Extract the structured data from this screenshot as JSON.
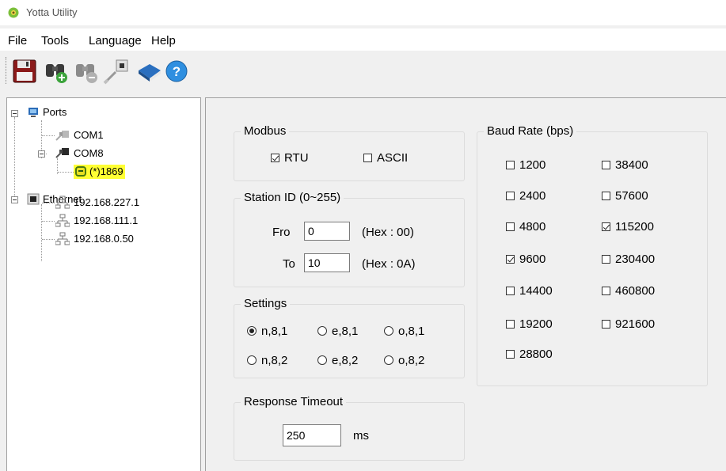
{
  "window": {
    "title": "Yotta Utility"
  },
  "menu": {
    "file": "File",
    "tools": "Tools",
    "language": "Language",
    "help": "Help"
  },
  "toolbar": {
    "buttons": [
      "save-icon",
      "search-add-icon",
      "search-remove-icon",
      "connect-icon",
      "book-icon",
      "help-icon"
    ]
  },
  "tree": {
    "ports_label": "Ports",
    "com1_label": "COM1",
    "com8_label": "COM8",
    "device_label": "(*)1869",
    "ethernet_label": "Ethernet",
    "ip1": "192.168.227.1",
    "ip2": "192.168.111.1",
    "ip3": "192.168.0.50"
  },
  "modbus": {
    "title": "Modbus",
    "rtu_label": "RTU",
    "rtu_checked": true,
    "ascii_label": "ASCII",
    "ascii_checked": false
  },
  "station": {
    "title": "Station ID (0~255)",
    "from_label": "Fro",
    "from_value": "0",
    "from_hex": "(Hex : 00)",
    "to_label": "To",
    "to_value": "10",
    "to_hex": "(Hex : 0A)"
  },
  "settings": {
    "title": "Settings",
    "options": [
      "n,8,1",
      "e,8,1",
      "o,8,1",
      "n,8,2",
      "e,8,2",
      "o,8,2"
    ],
    "selected": "n,8,1"
  },
  "timeout": {
    "title": "Response Timeout",
    "value": "250",
    "unit": "ms"
  },
  "baud": {
    "title": "Baud Rate (bps)",
    "left": [
      {
        "label": "1200",
        "checked": false
      },
      {
        "label": "2400",
        "checked": false
      },
      {
        "label": "4800",
        "checked": false
      },
      {
        "label": "9600",
        "checked": true
      },
      {
        "label": "14400",
        "checked": false
      },
      {
        "label": "19200",
        "checked": false
      },
      {
        "label": "28800",
        "checked": false
      }
    ],
    "right": [
      {
        "label": "38400",
        "checked": false
      },
      {
        "label": "57600",
        "checked": false
      },
      {
        "label": "115200",
        "checked": true
      },
      {
        "label": "230400",
        "checked": false
      },
      {
        "label": "460800",
        "checked": false
      },
      {
        "label": "921600",
        "checked": false
      }
    ]
  },
  "colors": {
    "highlight": "#ffff33",
    "panel": "#f0f0f0",
    "border": "#a0a0a0"
  }
}
